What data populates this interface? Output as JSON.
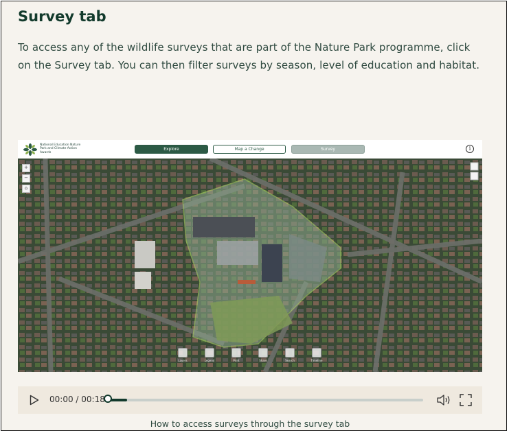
{
  "heading": "Survey tab",
  "intro": "To access any of the wildlife surveys that are part of the Nature Park programme, click on the Survey tab. You can then filter surveys by season, level of education and habitat.",
  "video": {
    "app": {
      "logo_text": "National Education Nature Park and Climate Action Awards",
      "tabs": [
        {
          "label": "Explore",
          "state": "active"
        },
        {
          "label": "Map a Change",
          "state": "default"
        },
        {
          "label": "Survey",
          "state": "hover"
        }
      ],
      "map_controls": [
        "+",
        "−",
        "⌂"
      ],
      "tools": [
        "Layers",
        "Legend",
        "Print",
        "Share",
        "Search",
        "Timeline"
      ]
    }
  },
  "player": {
    "time": "00:00 / 00:18",
    "progress": 0.0,
    "buffered": 0.06
  },
  "caption": "How to access surveys through the survey tab",
  "colors": {
    "brand_green": "#123a2c",
    "text": "#2f4a40",
    "background": "#f6f3ee"
  }
}
